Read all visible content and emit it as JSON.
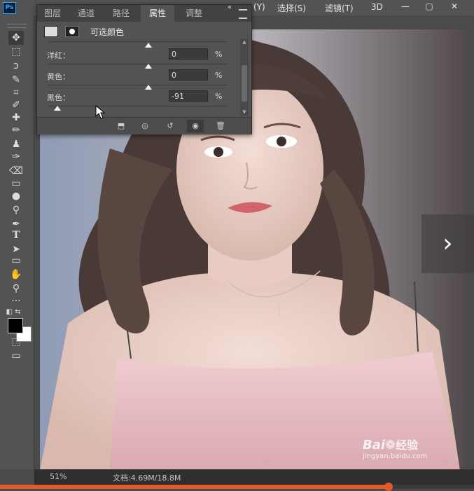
{
  "menubar": {
    "logo": "Ps",
    "items": [
      "(Y)",
      "选择(S)",
      "滤镜(T)",
      "3D"
    ]
  },
  "tools": [
    "move-tool",
    "marquee-tool",
    "lasso-tool",
    "quick-select-tool",
    "crop-tool",
    "eyedropper-tool",
    "healing-tool",
    "brush-tool",
    "stamp-tool",
    "history-brush-tool",
    "eraser-tool",
    "gradient-tool",
    "blur-tool",
    "dodge-tool",
    "pen-tool",
    "type-tool",
    "path-select-tool",
    "rectangle-tool",
    "hand-tool",
    "zoom-tool",
    "more-tools"
  ],
  "type_tool_glyph": "T",
  "panel": {
    "tabs": [
      "图层",
      "通道",
      "路径",
      "属性",
      "调整"
    ],
    "active_tab": "属性",
    "title": "可选颜色",
    "rows": [
      {
        "label": "洋红：",
        "value": "0",
        "unit": "%",
        "slider": 0.56
      },
      {
        "label": "黄色：",
        "value": "0",
        "unit": "%",
        "slider": 0.56
      },
      {
        "label": "黑色：",
        "value": "-91",
        "unit": "%",
        "slider": 0.05
      }
    ],
    "top_slider": 0.56
  },
  "status": {
    "zoom": "51%",
    "doc": "文档:4.69M/18.8M"
  },
  "video_progress": 0.82,
  "watermark": {
    "brand": "Bai",
    "brand2": "经验",
    "url": "jingyan.baidu.com"
  },
  "colors": {
    "accent": "#31a8ff",
    "progress": "#e05a2a"
  }
}
